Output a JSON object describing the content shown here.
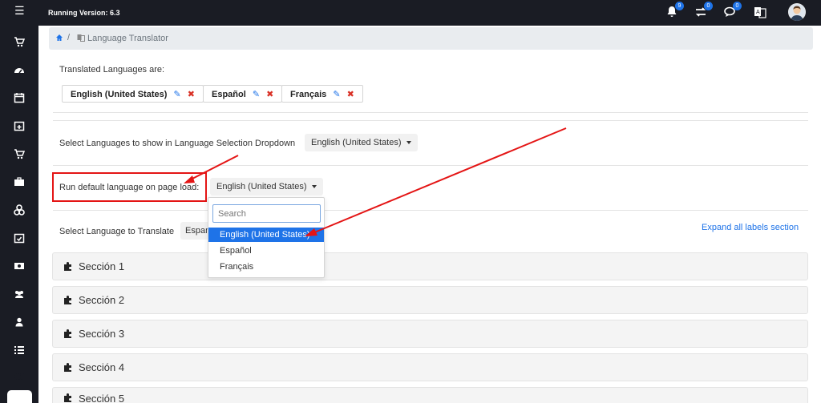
{
  "topbar": {
    "version": "Running Version: 6.3",
    "icons": [
      {
        "name": "bell-icon",
        "badge": "9"
      },
      {
        "name": "exchange-icon",
        "badge": "0"
      },
      {
        "name": "chat-icon",
        "badge": "0"
      },
      {
        "name": "translate-icon",
        "badge": ""
      }
    ]
  },
  "sidebar": {
    "icons": [
      "cart-icon",
      "dashboard-icon",
      "calendar-icon",
      "calendar-plus-icon",
      "cart-icon",
      "briefcase-icon",
      "cubes-icon",
      "calendar-check-icon",
      "money-icon",
      "users-icon",
      "user-icon",
      "list-icon",
      "cogs-icon"
    ]
  },
  "breadcrumb": {
    "current": "Language Translator"
  },
  "translated": {
    "heading": "Translated Languages are:",
    "languages": [
      "English (United States)",
      "Español",
      "Français"
    ]
  },
  "dropdown_select": {
    "label": "Select Languages to show in Language Selection Dropdown",
    "value": "English (United States)"
  },
  "default_lang": {
    "label": "Run default language on page load:",
    "value": "English (United States)"
  },
  "dropdown": {
    "search_placeholder": "Search",
    "options": [
      "English (United States)",
      "Español",
      "Français"
    ],
    "selected_index": 0
  },
  "translate_select": {
    "label": "Select Language to Translate",
    "value": "Espan"
  },
  "expand_link": "Expand all labels section",
  "sections": [
    "Sección 1",
    "Sección 2",
    "Sección 3",
    "Sección 4",
    "Sección 5"
  ],
  "colors": {
    "dark": "#1a1c24",
    "accent": "#1e73e8",
    "annotation": "#e41515"
  }
}
